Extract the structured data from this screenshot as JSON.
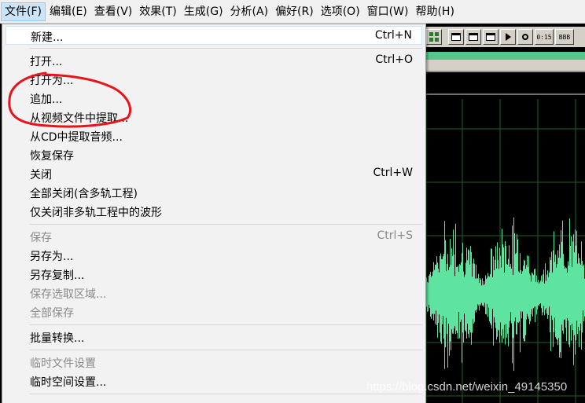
{
  "menubar": {
    "items": [
      {
        "label": "文件(F)",
        "active": true
      },
      {
        "label": "编辑(E)"
      },
      {
        "label": "查看(V)"
      },
      {
        "label": "效果(T)"
      },
      {
        "label": "生成(G)"
      },
      {
        "label": "分析(A)"
      },
      {
        "label": "偏好(R)"
      },
      {
        "label": "选项(O)"
      },
      {
        "label": "窗口(W)"
      },
      {
        "label": "帮助(H)"
      }
    ]
  },
  "toolbar": {
    "time_button": "0:15",
    "dots_button": "BBB"
  },
  "file_menu": {
    "items": [
      {
        "label": "新建...",
        "shortcut": "Ctrl+N",
        "highlight": true
      },
      {
        "label": "打开...",
        "shortcut": "Ctrl+O"
      },
      {
        "label": "打开为...",
        "shortcut": ""
      },
      {
        "label": "追加...",
        "shortcut": ""
      },
      {
        "label": "从视频文件中提取...",
        "shortcut": ""
      },
      {
        "label": "从CD中提取音频...",
        "shortcut": ""
      },
      {
        "label": "恢复保存",
        "shortcut": ""
      },
      {
        "label": "关闭",
        "shortcut": "Ctrl+W"
      },
      {
        "label": "全部关闭(含多轨工程)",
        "shortcut": ""
      },
      {
        "label": "仅关闭非多轨工程中的波形",
        "shortcut": ""
      },
      {
        "label": "保存",
        "shortcut": "Ctrl+S",
        "disabled": true
      },
      {
        "label": "另存为...",
        "shortcut": ""
      },
      {
        "label": "另存复制...",
        "shortcut": ""
      },
      {
        "label": "保存选取区域...",
        "shortcut": "",
        "disabled": true
      },
      {
        "label": "全部保存",
        "shortcut": "",
        "disabled": true
      },
      {
        "label": "批量转换...",
        "shortcut": ""
      },
      {
        "label": "临时文件设置",
        "shortcut": "",
        "disabled": true
      },
      {
        "label": "临时空间设置...",
        "shortcut": ""
      }
    ]
  },
  "colors": {
    "waveform": "#5fe3a0",
    "grid": "#1f5f2f",
    "annotation": "#e8141a"
  },
  "watermark": "https://blog.csdn.net/weixin_49145350"
}
